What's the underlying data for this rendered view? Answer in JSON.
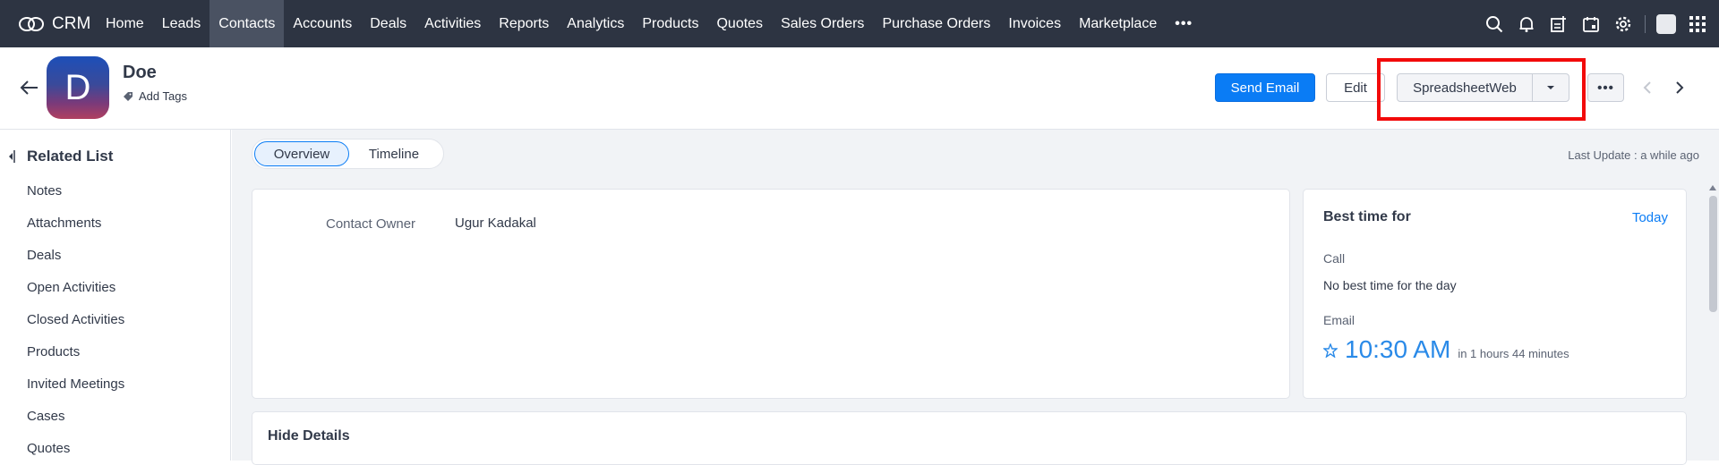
{
  "app": {
    "name": "CRM"
  },
  "nav": {
    "items": [
      "Home",
      "Leads",
      "Contacts",
      "Accounts",
      "Deals",
      "Activities",
      "Reports",
      "Analytics",
      "Products",
      "Quotes",
      "Sales Orders",
      "Purchase Orders",
      "Invoices",
      "Marketplace"
    ],
    "active": "Contacts",
    "more": "•••"
  },
  "contact": {
    "initial": "D",
    "name": "Doe",
    "add_tags": "Add Tags"
  },
  "actions": {
    "send_email": "Send Email",
    "edit": "Edit",
    "spreadsheetweb": "SpreadsheetWeb",
    "more": "•••"
  },
  "related_list": {
    "title": "Related List",
    "items": [
      "Notes",
      "Attachments",
      "Deals",
      "Open Activities",
      "Closed Activities",
      "Products",
      "Invited Meetings",
      "Cases",
      "Quotes"
    ]
  },
  "tabs": {
    "overview": "Overview",
    "timeline": "Timeline",
    "active": "Overview"
  },
  "last_update": "Last Update : a while ago",
  "overview": {
    "owner_label": "Contact Owner",
    "owner_value": "Ugur Kadakal"
  },
  "best_time": {
    "title": "Best time for",
    "today": "Today",
    "call_label": "Call",
    "call_value": "No best time for the day",
    "email_label": "Email",
    "email_time": "10:30 AM",
    "email_relative": "in 1 hours 44 minutes"
  },
  "details": {
    "hide_label": "Hide Details"
  },
  "colors": {
    "nav_bg": "#2d3442",
    "accent": "#0a7cf5",
    "highlight": "#f20a0a"
  }
}
